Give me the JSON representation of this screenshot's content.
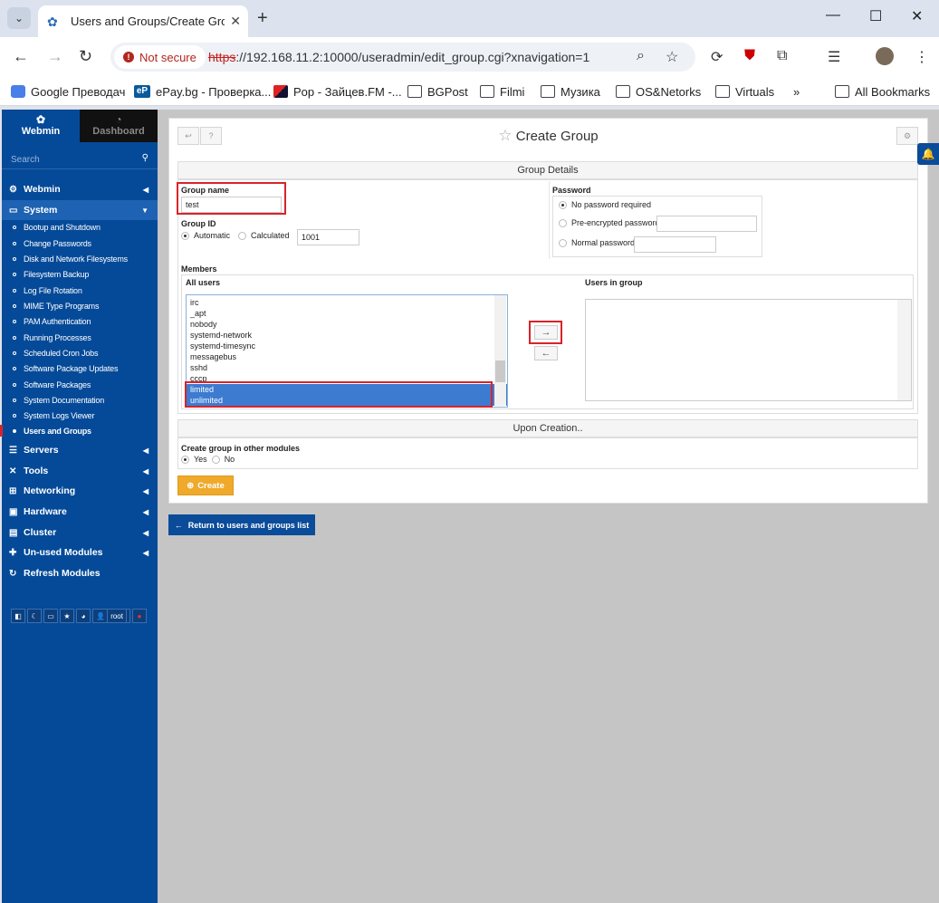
{
  "browser": {
    "tab_title": "Users and Groups/Create Group",
    "not_secure": "Not secure",
    "url_scheme": "https",
    "url_rest": "://192.168.11.2:10000/useradmin/edit_group.cgi?xnavigation=1",
    "bookmarks": [
      "Google Преводач",
      "ePay.bg - Проверка...",
      "Pop - Зайцев.FM -...",
      "BGPost",
      "Filmi",
      "Музика",
      "OS&Netorks",
      "Virtuals"
    ],
    "more_bookmarks": "»",
    "all_bookmarks": "All Bookmarks",
    "epay_icon_text": "eP"
  },
  "sidebar": {
    "tab_webmin": "Webmin",
    "tab_dashboard": "Dashboard",
    "search_placeholder": "Search",
    "menu": [
      {
        "label": "Webmin"
      },
      {
        "label": "System"
      }
    ],
    "system_items": [
      "Bootup and Shutdown",
      "Change Passwords",
      "Disk and Network Filesystems",
      "Filesystem Backup",
      "Log File Rotation",
      "MIME Type Programs",
      "PAM Authentication",
      "Running Processes",
      "Scheduled Cron Jobs",
      "Software Package Updates",
      "Software Packages",
      "System Documentation",
      "System Logs Viewer",
      "Users and Groups"
    ],
    "menu_after": [
      "Servers",
      "Tools",
      "Networking",
      "Hardware",
      "Cluster",
      "Un-used Modules",
      "Refresh Modules"
    ],
    "bottom_user": "root"
  },
  "page": {
    "title": "Create Group",
    "section_details": "Group Details",
    "group_name_label": "Group name",
    "group_name_value": "test",
    "group_id_label": "Group ID",
    "gid_automatic": "Automatic",
    "gid_calculated": "Calculated",
    "gid_value": "1001",
    "password_label": "Password",
    "pw_none": "No password required",
    "pw_preenc": "Pre-encrypted password",
    "pw_normal": "Normal password",
    "members_label": "Members",
    "all_users_label": "All users",
    "users_in_group_label": "Users in group",
    "all_users": [
      "irc",
      "_apt",
      "nobody",
      "systemd-network",
      "systemd-timesync",
      "messagebus",
      "sshd",
      "cccp",
      "limited",
      "unlimited"
    ],
    "section_creation": "Upon Creation..",
    "create_other_label": "Create group in other modules",
    "yes": "Yes",
    "no": "No",
    "create_button": "Create",
    "return_button": "Return to users and groups list"
  }
}
